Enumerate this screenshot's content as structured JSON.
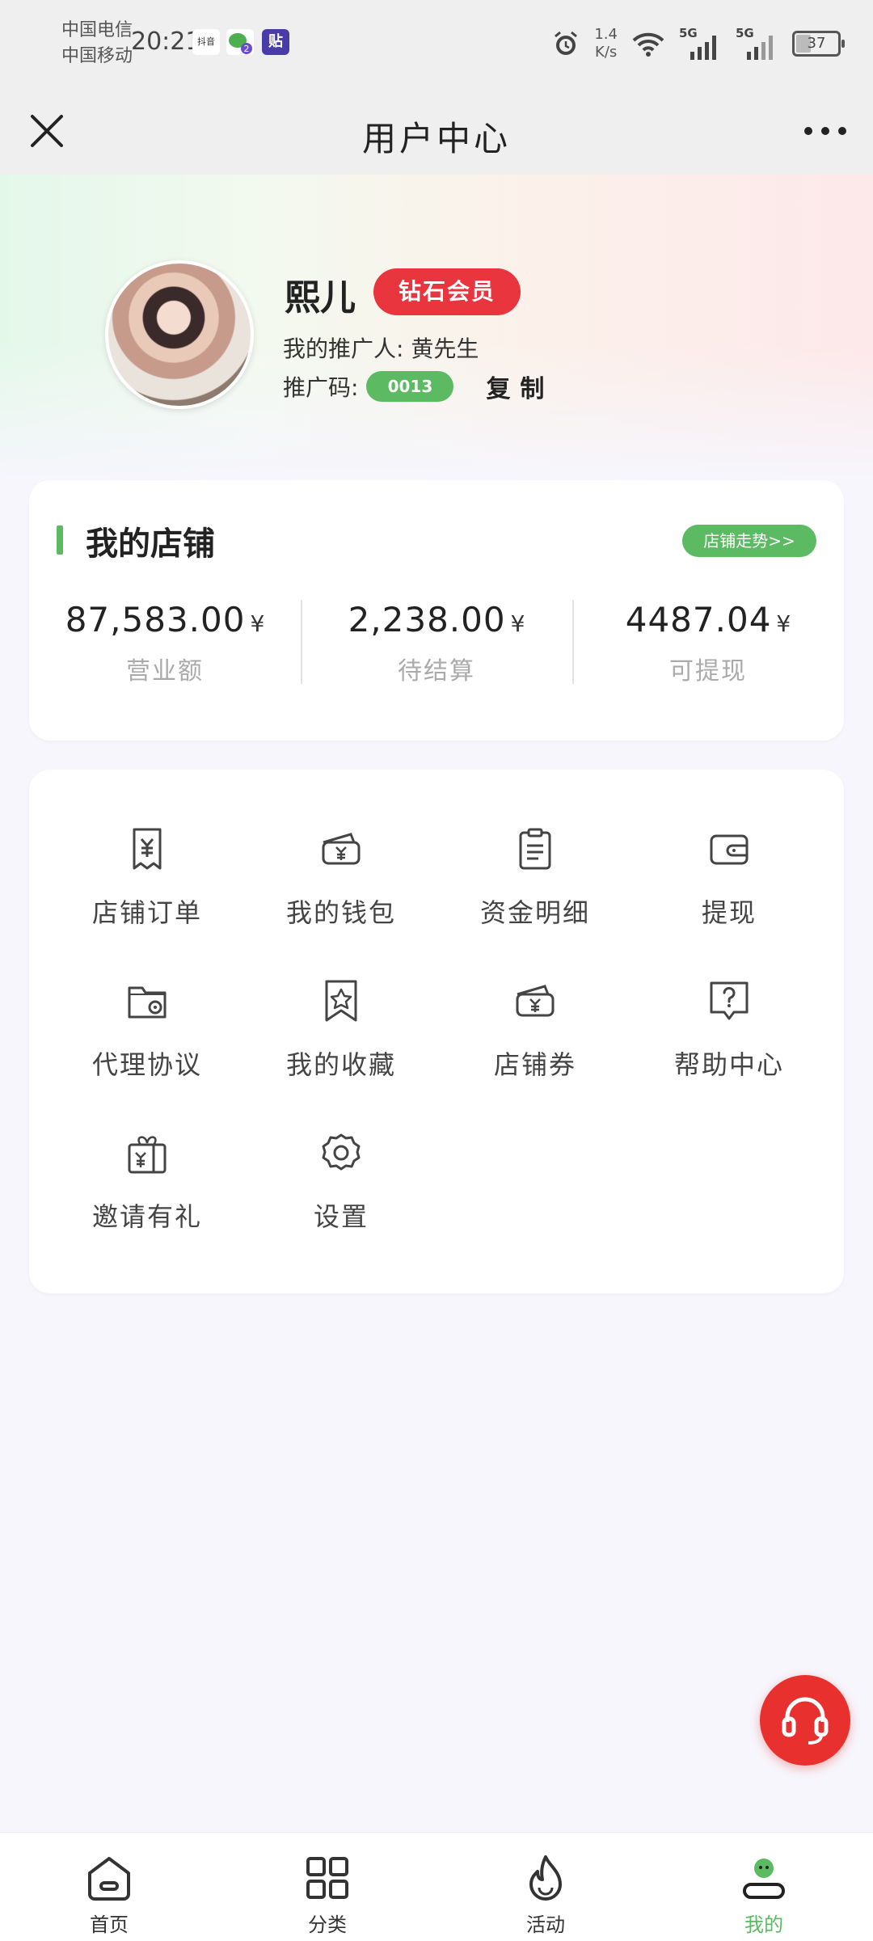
{
  "status_bar": {
    "carrier_1": "中国电信",
    "carrier_2": "中国移动",
    "time": "20:21",
    "notif_1": "抖音",
    "notif_2": "2",
    "notif_3": "贴",
    "net_speed_value": "1.4",
    "net_speed_unit": "K/s",
    "signal_1": "5G",
    "signal_2": "5G",
    "battery": "37"
  },
  "titlebar": {
    "title": "用户中心"
  },
  "profile": {
    "name": "熙儿",
    "badge": "钻石会员",
    "referrer": "我的推广人: 黄先生",
    "promo_label": "推广码:",
    "promo_code": "0013",
    "copy": "复制"
  },
  "shop": {
    "title": "我的店铺",
    "trend_button": "店铺走势>>",
    "stats": [
      {
        "value": "87,583.00",
        "unit": "¥",
        "label": "营业额"
      },
      {
        "value": "2,238.00",
        "unit": "¥",
        "label": "待结算"
      },
      {
        "value": "4487.04",
        "unit": "¥",
        "label": "可提现"
      }
    ]
  },
  "menu": [
    {
      "label": "店铺订单",
      "icon": "receipt-yen-icon"
    },
    {
      "label": "我的钱包",
      "icon": "wallet-yen-icon"
    },
    {
      "label": "资金明细",
      "icon": "clipboard-list-icon"
    },
    {
      "label": "提现",
      "icon": "purse-icon"
    },
    {
      "label": "代理协议",
      "icon": "folder-agreement-icon"
    },
    {
      "label": "我的收藏",
      "icon": "star-bookmark-icon"
    },
    {
      "label": "店铺券",
      "icon": "coupon-yen-icon"
    },
    {
      "label": "帮助中心",
      "icon": "help-question-icon"
    },
    {
      "label": "邀请有礼",
      "icon": "gift-icon"
    },
    {
      "label": "设置",
      "icon": "gear-icon"
    }
  ],
  "tabs": [
    {
      "label": "首页",
      "icon": "home-icon"
    },
    {
      "label": "分类",
      "icon": "grid-icon"
    },
    {
      "label": "活动",
      "icon": "flame-icon"
    },
    {
      "label": "我的",
      "icon": "user-icon"
    }
  ],
  "colors": {
    "accent_green": "#5cba63",
    "vip_red": "#e8353e",
    "service_red": "#e8312f"
  }
}
